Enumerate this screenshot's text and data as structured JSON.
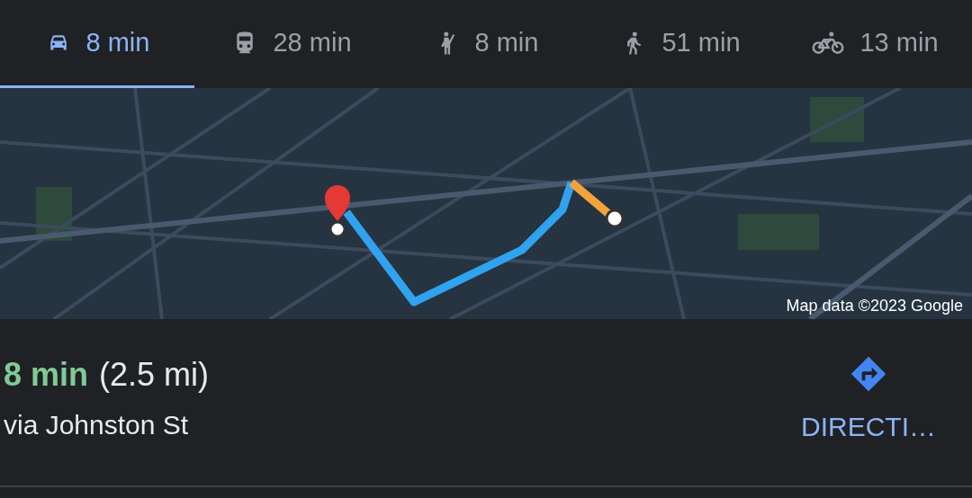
{
  "tabs": [
    {
      "kind": "car",
      "label": "8 min",
      "selected": true
    },
    {
      "kind": "transit",
      "label": "28 min",
      "selected": false
    },
    {
      "kind": "ride",
      "label": "8 min",
      "selected": false
    },
    {
      "kind": "walk",
      "label": "51 min",
      "selected": false
    },
    {
      "kind": "bike",
      "label": "13 min",
      "selected": false
    }
  ],
  "map": {
    "kind": "picture",
    "attribution": "Map data ©2023 Google"
  },
  "route": {
    "duration": "8 min",
    "distance": "(2.5 mi)",
    "via": "via Johnston St",
    "action": "DIRECTI…"
  }
}
